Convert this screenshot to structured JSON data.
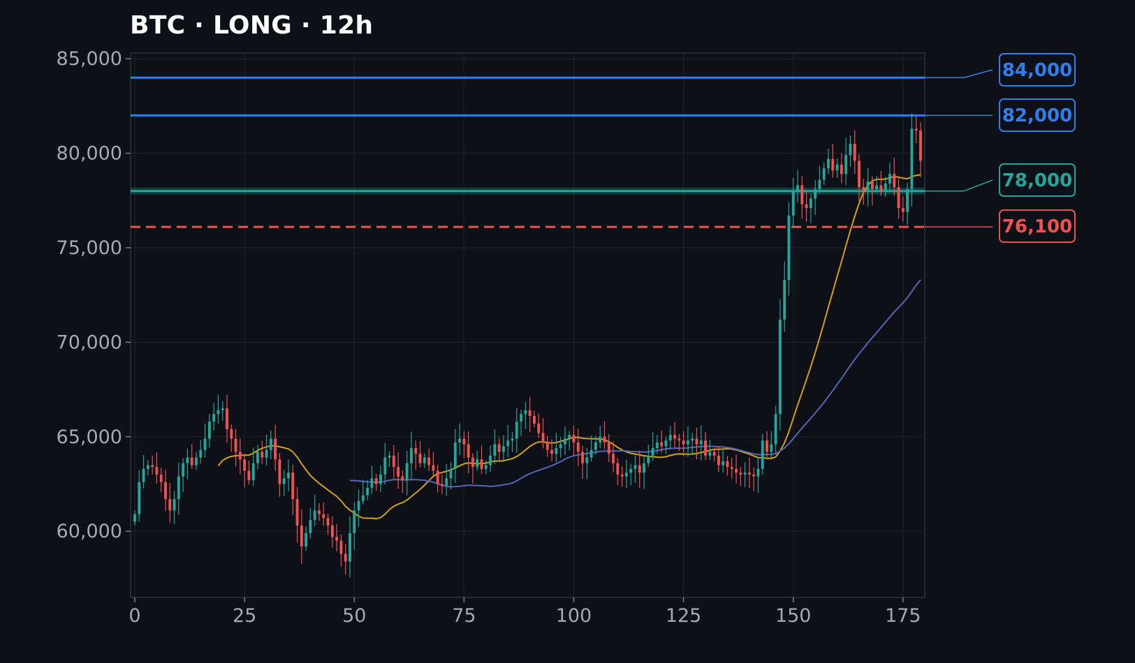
{
  "title": "BTC · LONG · 12h",
  "chart_data": {
    "type": "candlestick",
    "title": "BTC · LONG · 12h",
    "xlabel": "",
    "ylabel": "",
    "xlim": [
      0,
      179
    ],
    "ylim": [
      56500,
      85300
    ],
    "x_ticks": [
      0,
      25,
      50,
      75,
      100,
      125,
      150,
      175
    ],
    "y_ticks": [
      60000,
      65000,
      70000,
      75000,
      80000,
      85000
    ],
    "y_tick_labels": [
      "60,000",
      "65,000",
      "70,000",
      "75,000",
      "80,000",
      "85,000"
    ],
    "x_tick_labels": [
      "0",
      "25",
      "50",
      "75",
      "100",
      "125",
      "150",
      "175"
    ],
    "grid": true,
    "colors": {
      "up": "#26a69a",
      "down": "#ef5350",
      "ma_fast": "#d4a017",
      "ma_slow": "#5566b8",
      "blue_level": "#2f80ed",
      "green_level": "#26a69a",
      "red_level": "#ef5350"
    },
    "closes": [
      60900,
      62600,
      63300,
      63500,
      63400,
      63000,
      62600,
      61700,
      61100,
      61700,
      62900,
      63600,
      63900,
      63500,
      63900,
      64300,
      64900,
      65800,
      66200,
      66400,
      66500,
      65400,
      64900,
      64200,
      63800,
      63200,
      62700,
      63600,
      64200,
      63900,
      64300,
      64900,
      63800,
      62500,
      62800,
      63100,
      61700,
      60300,
      59200,
      59900,
      60600,
      61100,
      60900,
      60700,
      60300,
      59700,
      59500,
      58800,
      58400,
      59900,
      61100,
      61600,
      61900,
      62300,
      62800,
      62500,
      63000,
      63900,
      64000,
      63400,
      62900,
      62700,
      63600,
      64400,
      64100,
      63600,
      63900,
      63500,
      63200,
      62500,
      62400,
      62800,
      63300,
      64700,
      64900,
      64600,
      63900,
      63400,
      63800,
      63300,
      63500,
      64000,
      64600,
      64200,
      64500,
      64800,
      64900,
      65800,
      66200,
      66400,
      66100,
      65700,
      65200,
      64700,
      64300,
      64100,
      64400,
      64600,
      64900,
      65100,
      64700,
      64200,
      63600,
      63900,
      64300,
      64700,
      65000,
      64700,
      64100,
      63600,
      63000,
      62900,
      63100,
      63300,
      63500,
      63100,
      63600,
      64000,
      64400,
      64700,
      64500,
      64800,
      65100,
      64900,
      64800,
      64600,
      64800,
      64900,
      64600,
      64800,
      64000,
      64200,
      64000,
      63500,
      63700,
      63400,
      63300,
      63100,
      63000,
      63100,
      63000,
      62900,
      63300,
      64800,
      64200,
      64600,
      66200,
      71200,
      73300,
      76700,
      78000,
      78300,
      77300,
      77100,
      77600,
      78100,
      78600,
      79200,
      79700,
      79100,
      79400,
      78900,
      79900,
      80500,
      79600,
      78200,
      78000,
      78500,
      78100,
      78300,
      78000,
      78400,
      78900,
      78200,
      77100,
      76900,
      78100,
      81300,
      81200,
      79600
    ],
    "price_levels": [
      {
        "value": 84000,
        "label": "84,000",
        "color": "#2f80ed",
        "style": "solid"
      },
      {
        "value": 82000,
        "label": "82,000",
        "color": "#2f80ed",
        "style": "solid"
      },
      {
        "value": 78000,
        "label": "78,000",
        "color": "#26a69a",
        "style": "solid-band"
      },
      {
        "value": 76100,
        "label": "76,100",
        "color": "#ef5350",
        "style": "dashed"
      }
    ],
    "moving_averages": [
      {
        "period": 20,
        "color": "#d4a017"
      },
      {
        "period": 50,
        "color": "#5566b8"
      }
    ]
  }
}
